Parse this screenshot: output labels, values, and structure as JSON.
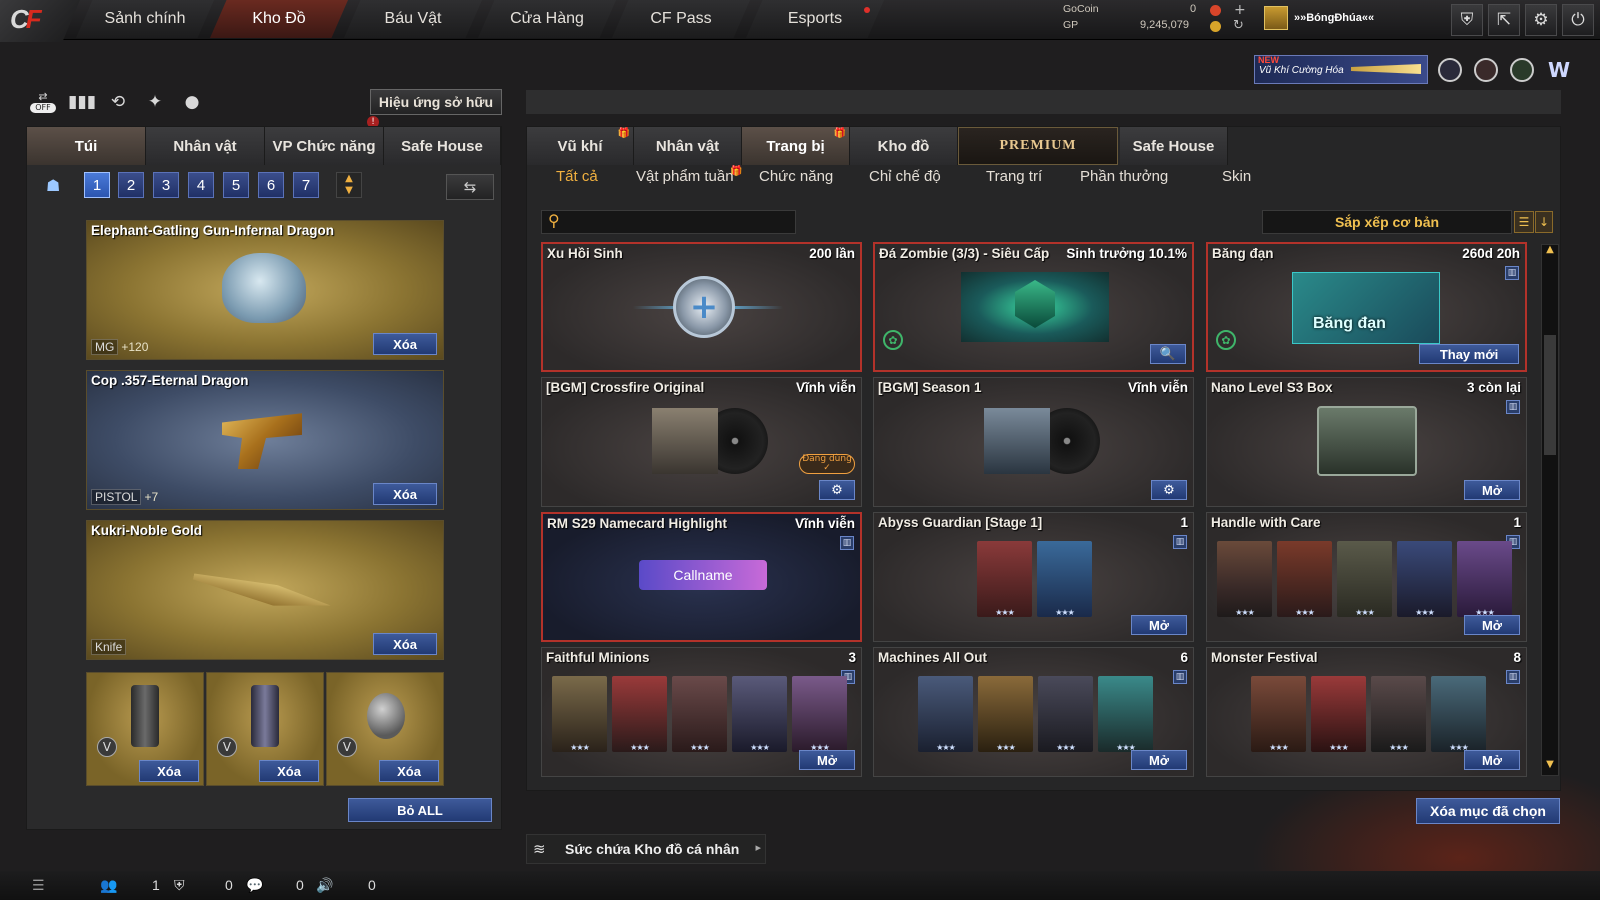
{
  "nav": {
    "tabs": [
      {
        "label": "Sảnh chính"
      },
      {
        "label": "Kho Đồ"
      },
      {
        "label": "Báu Vật"
      },
      {
        "label": "Cửa Hàng"
      },
      {
        "label": "CF Pass"
      },
      {
        "label": "Esports"
      }
    ],
    "gocoin_label": "GoCoin",
    "gocoin_value": "0",
    "gp_label": "GP",
    "gp_value": "9,245,079",
    "username": "»»BóngĐhúa««",
    "promo_new": "NEW",
    "promo_text": "Vũ Khí Cường Hóa"
  },
  "left": {
    "effect_button": "Hiệu ứng sở hữu",
    "off_label": "OFF",
    "tabs": [
      "Túi",
      "Nhân vật",
      "VP Chức năng",
      "Safe House"
    ],
    "pages": [
      "1",
      "2",
      "3",
      "4",
      "5",
      "6",
      "7"
    ],
    "items": [
      {
        "name": "Elephant-Gatling Gun-Infernal Dragon",
        "type": "MG",
        "bonus": "+120",
        "delete": "Xóa"
      },
      {
        "name": "Cop .357-Eternal Dragon",
        "type": "PISTOL",
        "bonus": "+7",
        "delete": "Xóa"
      },
      {
        "name": "Kukri-Noble Gold",
        "type": "Knife",
        "bonus": "",
        "delete": "Xóa"
      }
    ],
    "small_items": [
      {
        "delete": "Xóa"
      },
      {
        "delete": "Xóa"
      },
      {
        "delete": "Xóa"
      }
    ],
    "remove_all": "Bỏ ALL"
  },
  "right": {
    "tabs": [
      "Vũ khí",
      "Nhân vật",
      "Trang bị",
      "Kho đồ",
      "PREMIUM",
      "Safe House"
    ],
    "subtabs": [
      "Tất cả",
      "Vật phẩm tuần",
      "Chức năng",
      "Chỉ chế độ",
      "Trang trí",
      "Phần thưởng",
      "Skin"
    ],
    "search_placeholder": "",
    "sort_label": "Sắp xếp cơ bản",
    "cards": [
      {
        "title": "Xu Hồi Sinh",
        "value": "200 lần"
      },
      {
        "title": "Đá Zombie (3/3) - Siêu Cấp",
        "value": "Sinh trưởng 10.1%"
      },
      {
        "title": "Băng đạn",
        "value": "260d 20h",
        "image_text": "Băng đạn",
        "action": "Thay mới"
      },
      {
        "title": "[BGM] Crossfire Original",
        "value": "Vĩnh viễn",
        "badge": "Đang dùng"
      },
      {
        "title": "[BGM] Season 1",
        "value": "Vĩnh viễn"
      },
      {
        "title": "Nano Level S3 Box",
        "value": "3 còn lại",
        "action": "Mở"
      },
      {
        "title": "RM S29 Namecard Highlight",
        "value": "Vĩnh viễn",
        "image_text": "Callname"
      },
      {
        "title": "Abyss Guardian [Stage 1]",
        "value": "1",
        "action": "Mở"
      },
      {
        "title": "Handle with Care",
        "value": "1",
        "action": "Mở"
      },
      {
        "title": "Faithful Minions",
        "value": "3",
        "action": "Mở"
      },
      {
        "title": "Machines All Out",
        "value": "6",
        "action": "Mở"
      },
      {
        "title": "Monster Festival",
        "value": "8",
        "action": "Mở"
      }
    ],
    "delete_selected": "Xóa mục đã chọn",
    "capacity_label": "Sức chứa Kho đồ cá nhân"
  },
  "bottom": {
    "friends": "1",
    "clan": "0",
    "chat": "0",
    "sound": "0"
  },
  "colors": {
    "accent_red": "#b3322a",
    "button_blue": "#2b4a8a",
    "active_sub": "#f0b040"
  }
}
